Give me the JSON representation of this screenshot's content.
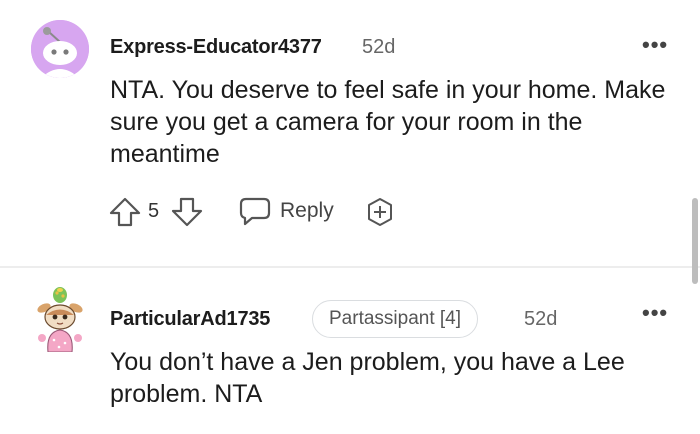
{
  "comments": [
    {
      "username": "Express-Educator4377",
      "age": "52d",
      "more": "•••",
      "body": "NTA. You deserve to feel safe in your home. Make sure you get a camera for your room in the meantime",
      "vote_count": "5",
      "reply_label": "Reply"
    },
    {
      "username": "ParticularAd1735",
      "flair": "Partassipant [4]",
      "age": "52d",
      "more": "•••",
      "body": "You don’t have a Jen problem, you have a Lee problem. NTA"
    }
  ],
  "icons": {
    "avatar1": "reddit-snoo-avatar",
    "avatar2": "custom-snoo-avatar",
    "upvote": "upvote-arrow-icon",
    "downvote": "downvote-arrow-icon",
    "reply": "speech-bubble-icon",
    "award": "award-icon",
    "more": "more-options-icon"
  },
  "colors": {
    "avatar_bg": "#d7a6f0",
    "text": "#1c1c1c",
    "muted": "#666666"
  }
}
